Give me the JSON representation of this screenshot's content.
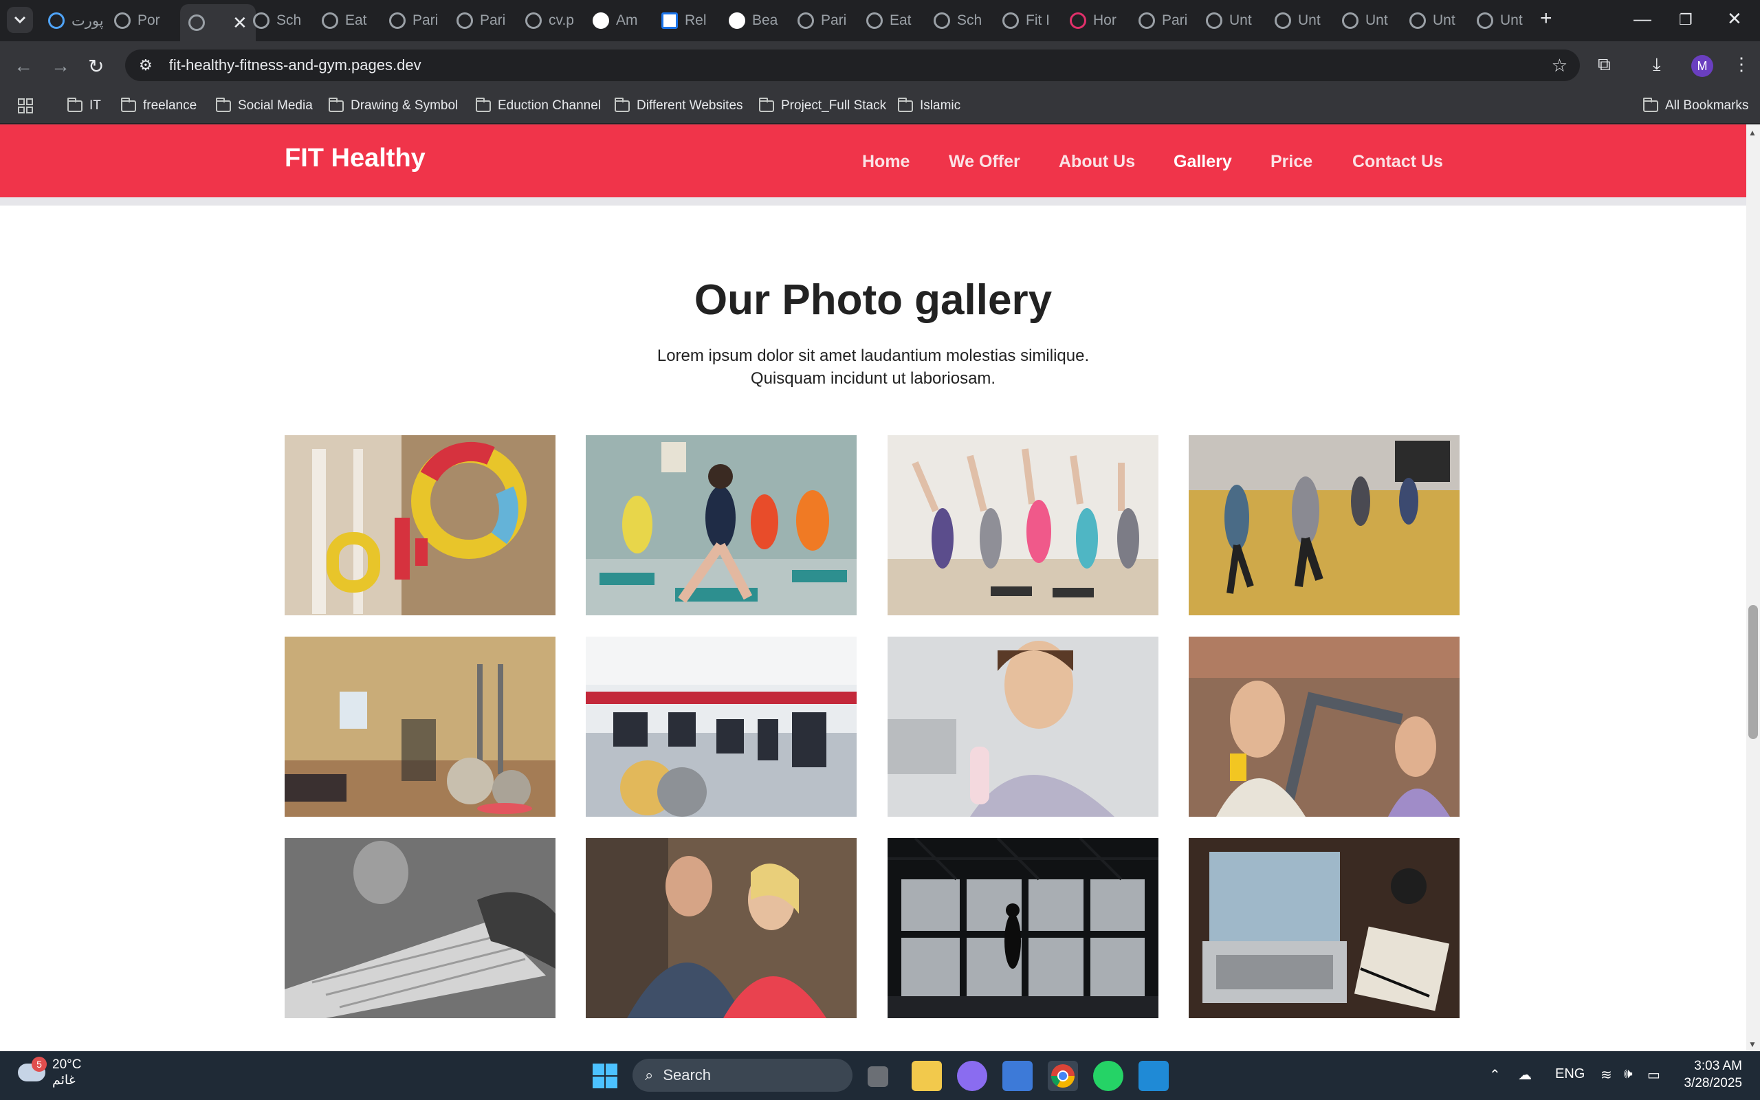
{
  "browser": {
    "tabs": [
      {
        "label": "پورت"
      },
      {
        "label": "Por"
      },
      {
        "label": ""
      },
      {
        "label": "Sch"
      },
      {
        "label": "Eat"
      },
      {
        "label": "Pari"
      },
      {
        "label": "Pari"
      },
      {
        "label": "cv.p"
      },
      {
        "label": "Am"
      },
      {
        "label": "Rel"
      },
      {
        "label": "Bea"
      },
      {
        "label": "Pari"
      },
      {
        "label": "Eat"
      },
      {
        "label": "Sch"
      },
      {
        "label": "Fit I"
      },
      {
        "label": "Hor"
      },
      {
        "label": "Pari"
      },
      {
        "label": "Unt"
      },
      {
        "label": "Unt"
      },
      {
        "label": "Unt"
      },
      {
        "label": "Unt"
      },
      {
        "label": "Unt"
      }
    ],
    "url": "fit-healthy-fitness-and-gym.pages.dev",
    "profile_initial": "M",
    "bookmarks": [
      "IT",
      "freelance",
      "Social Media",
      "Drawing & Symbol",
      "Eduction Channel",
      "Different Websites",
      "Project_Full Stack",
      "Islamic"
    ],
    "all_bookmarks_label": "All Bookmarks"
  },
  "site": {
    "brand": "FIT Healthy",
    "nav": [
      "Home",
      "We Offer",
      "About Us",
      "Gallery",
      "Price",
      "Contact Us"
    ],
    "active_nav": "Gallery",
    "accent_color": "#f0344a"
  },
  "gallery": {
    "title": "Our Photo gallery",
    "subtitle": "Lorem ipsum dolor sit amet laudantium molestias similique. Quisquam incidunt ut laboriosam."
  },
  "taskbar": {
    "weather_temp": "20°C",
    "weather_desc": "غائم",
    "weather_badge": "5",
    "search_label": "Search",
    "lang": "ENG",
    "time": "3:03 AM",
    "date": "3/28/2025"
  }
}
